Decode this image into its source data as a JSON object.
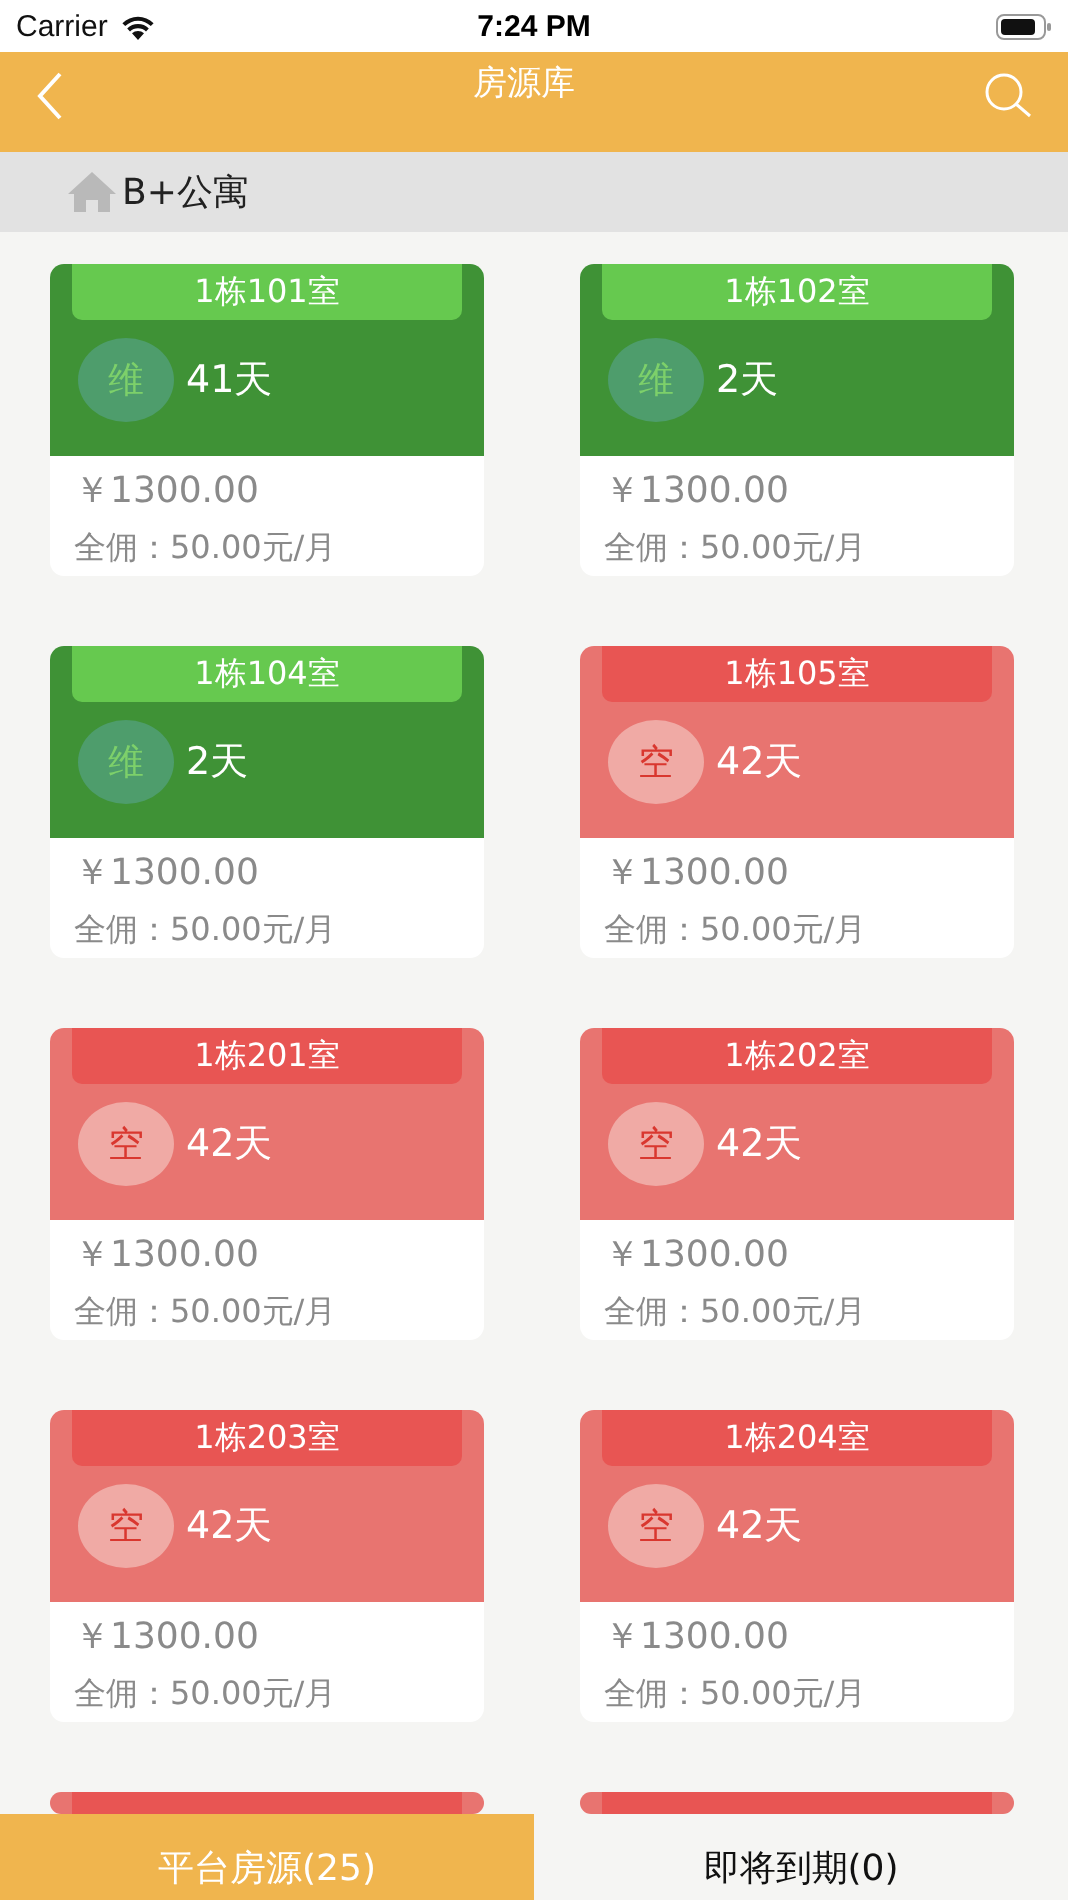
{
  "status_bar": {
    "carrier": "Carrier",
    "time": "7:24 PM"
  },
  "nav": {
    "title": "房源库"
  },
  "breadcrumb": {
    "label": "B+公寓"
  },
  "rooms": [
    {
      "title": "1栋101室",
      "color": "#3f9236",
      "badge": "维",
      "days": "41天",
      "price": "￥1300.00",
      "commission": "全佣：50.00元/月"
    },
    {
      "title": "1栋102室",
      "color": "#3f9236",
      "badge": "维",
      "days": "2天",
      "price": "￥1300.00",
      "commission": "全佣：50.00元/月"
    },
    {
      "title": "1栋104室",
      "color": "#3f9236",
      "badge": "维",
      "days": "2天",
      "price": "￥1300.00",
      "commission": "全佣：50.00元/月"
    },
    {
      "title": "1栋105室",
      "color": "#e87470",
      "badge": "空",
      "days": "42天",
      "price": "￥1300.00",
      "commission": "全佣：50.00元/月"
    },
    {
      "title": "1栋201室",
      "color": "#e87470",
      "badge": "空",
      "days": "42天",
      "price": "￥1300.00",
      "commission": "全佣：50.00元/月"
    },
    {
      "title": "1栋202室",
      "color": "#e87470",
      "badge": "空",
      "days": "42天",
      "price": "￥1300.00",
      "commission": "全佣：50.00元/月"
    },
    {
      "title": "1栋203室",
      "color": "#e87470",
      "badge": "空",
      "days": "42天",
      "price": "￥1300.00",
      "commission": "全佣：50.00元/月"
    },
    {
      "title": "1栋204室",
      "color": "#e87470",
      "badge": "空",
      "days": "42天",
      "price": "￥1300.00",
      "commission": "全佣：50.00元/月"
    },
    {
      "color": "#e87470"
    },
    {
      "color": "#e87470"
    }
  ],
  "tabs": [
    {
      "label": "平台房源(25)",
      "selected": true
    },
    {
      "label": "即将到期(0)",
      "selected": false
    }
  ]
}
